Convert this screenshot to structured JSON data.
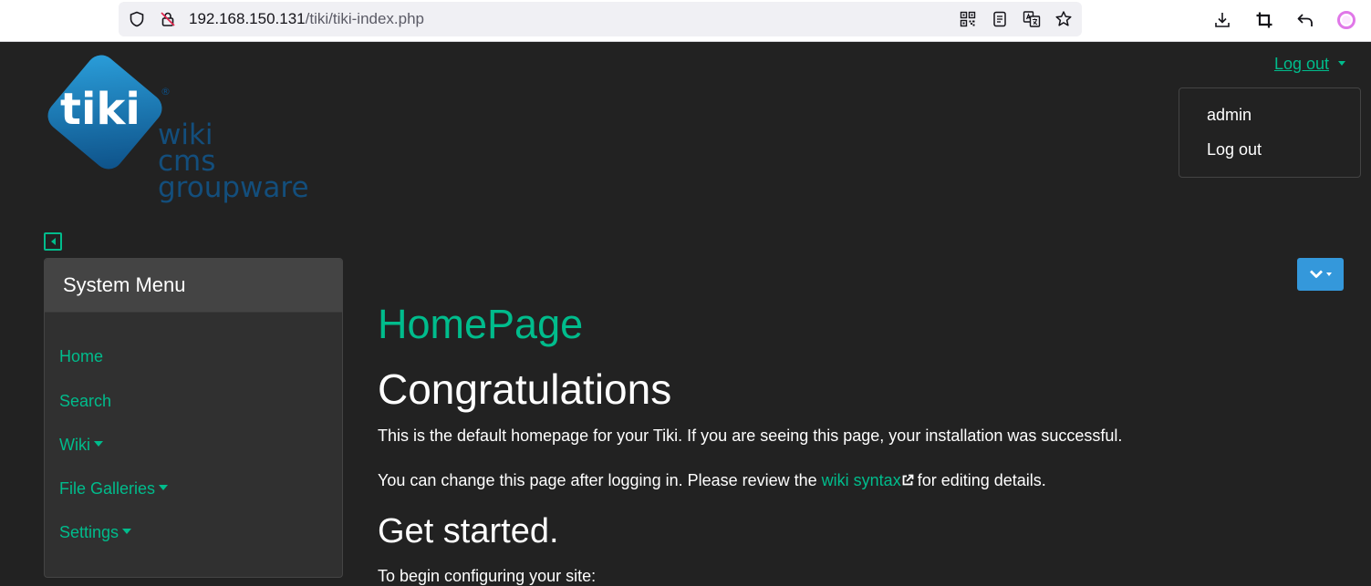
{
  "browser": {
    "url_host": "192.168.150.131",
    "url_path": "/tiki/tiki-index.php"
  },
  "logo": {
    "brand": "tiki",
    "line1": "wiki",
    "line2": "cms",
    "line3": "groupware",
    "registered": "®"
  },
  "user_menu": {
    "toggle_label": "Log out",
    "items": [
      "admin",
      "Log out"
    ]
  },
  "system_menu": {
    "title": "System Menu",
    "items": [
      {
        "label": "Home",
        "has_caret": false
      },
      {
        "label": "Search",
        "has_caret": false
      },
      {
        "label": "Wiki",
        "has_caret": true
      },
      {
        "label": "File Galleries",
        "has_caret": true
      },
      {
        "label": "Settings",
        "has_caret": true
      }
    ]
  },
  "content": {
    "page_title": "HomePage",
    "heading1": "Congratulations",
    "para1": "This is the default homepage for your Tiki. If you are seeing this page, your installation was successful.",
    "para2_before": "You can change this page after logging in. Please review the ",
    "para2_link": "wiki syntax",
    "para2_after": "for editing details.",
    "heading2": "Get started.",
    "para3": "To begin configuring your site:"
  },
  "colors": {
    "background": "#222222",
    "accent": "#00bc8c",
    "menu_panel": "#303030",
    "menu_header": "#444444",
    "action_button": "#3498db"
  },
  "icons": [
    "shield-icon",
    "insecure-lock-icon",
    "qr-code-icon",
    "reader-view-icon",
    "translate-icon",
    "bookmark-star-icon",
    "download-icon",
    "crop-icon",
    "undo-icon",
    "extension-circle-icon",
    "sidebar-collapse-icon",
    "chevron-down-icon",
    "external-link-icon"
  ]
}
